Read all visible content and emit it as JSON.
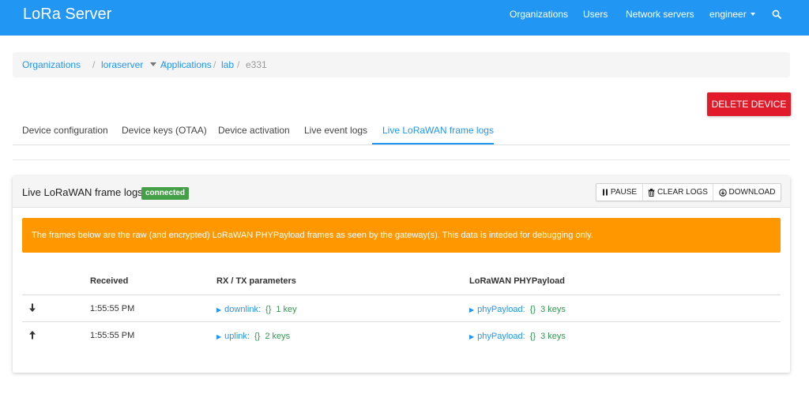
{
  "header": {
    "brand": "LoRa Server",
    "nav": {
      "organizations": "Organizations",
      "users": "Users",
      "network_servers": "Network servers",
      "user": "engineer"
    }
  },
  "breadcrumb": {
    "organizations": "Organizations",
    "org": "loraserver",
    "applications": "Applications",
    "application": "lab",
    "device": "e331",
    "sep": "/"
  },
  "actions": {
    "delete_device": "DELETE DEVICE"
  },
  "tabs": [
    {
      "label": "Device configuration"
    },
    {
      "label": "Device keys (OTAA)"
    },
    {
      "label": "Device activation"
    },
    {
      "label": "Live event logs"
    },
    {
      "label": "Live LoRaWAN frame logs"
    }
  ],
  "card": {
    "title": "Live LoRaWAN frame logs",
    "status": "connected",
    "buttons": {
      "pause": "PAUSE",
      "clear": "CLEAR LOGS",
      "download": "DOWNLOAD"
    },
    "alert": "The frames below are the raw (and encrypted) LoRaWAN PHYPayload frames as seen by the gateway(s). This data is inteded for debugging only."
  },
  "table": {
    "headers": {
      "received": "Received",
      "rxtx": "RX / TX parameters",
      "payload": "LoRaWAN PHYPayload"
    },
    "rows": [
      {
        "direction": "downlink-arrow-icon",
        "time": "1:55:55 PM",
        "param_key": "downlink:",
        "param_brace": "{}",
        "param_count": "1 key",
        "payload_key": "phyPayload:",
        "payload_brace": "{}",
        "payload_count": "3 keys"
      },
      {
        "direction": "uplink-arrow-icon",
        "time": "1:55:55 PM",
        "param_key": "uplink:",
        "param_brace": "{}",
        "param_count": "2 keys",
        "payload_key": "phyPayload:",
        "payload_brace": "{}",
        "payload_count": "3 keys"
      }
    ]
  },
  "colors": {
    "primary": "#2196f3",
    "danger": "#e21b2b",
    "warning": "#ff9800",
    "success": "#43a047",
    "json_value": "#2e9a4f"
  }
}
